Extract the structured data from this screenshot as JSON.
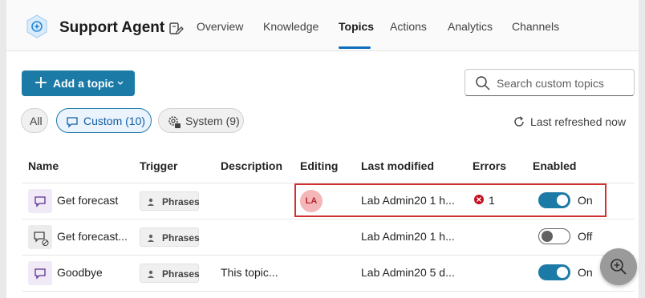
{
  "header": {
    "agent_name": "Support Agent",
    "tabs": [
      {
        "label": "Overview"
      },
      {
        "label": "Knowledge"
      },
      {
        "label": "Topics",
        "active": true
      },
      {
        "label": "Actions"
      },
      {
        "label": "Analytics"
      },
      {
        "label": "Channels"
      }
    ]
  },
  "toolbar": {
    "add_topic_label": "Add a topic",
    "search_placeholder": "Search custom topics"
  },
  "filters": [
    {
      "label": "All"
    },
    {
      "label": "Custom (10)",
      "selected": true
    },
    {
      "label": "System (9)"
    }
  ],
  "refresh_label": "Last refreshed now",
  "table": {
    "columns": [
      "Name",
      "Trigger",
      "Description",
      "Editing",
      "Last modified",
      "Errors",
      "Enabled"
    ],
    "rows": [
      {
        "name": "Get forecast",
        "trigger": "Phrases",
        "description": "",
        "editing": "LA",
        "last_modified": "Lab Admin20  1 h...",
        "errors": "1",
        "enabled": "On",
        "enabled_state": true
      },
      {
        "name": "Get forecast...",
        "trigger": "Phrases",
        "description": "",
        "editing": "",
        "last_modified": "Lab Admin20  1 h...",
        "errors": "",
        "enabled": "Off",
        "enabled_state": false
      },
      {
        "name": "Goodbye",
        "trigger": "Phrases",
        "description": "This topic...",
        "editing": "",
        "last_modified": "Lab Admin20  5 d...",
        "errors": "",
        "enabled": "On",
        "enabled_state": true
      }
    ]
  },
  "colors": {
    "accent": "#1c7aa6",
    "error": "#c50f1f",
    "highlight": "#d32f2f"
  }
}
